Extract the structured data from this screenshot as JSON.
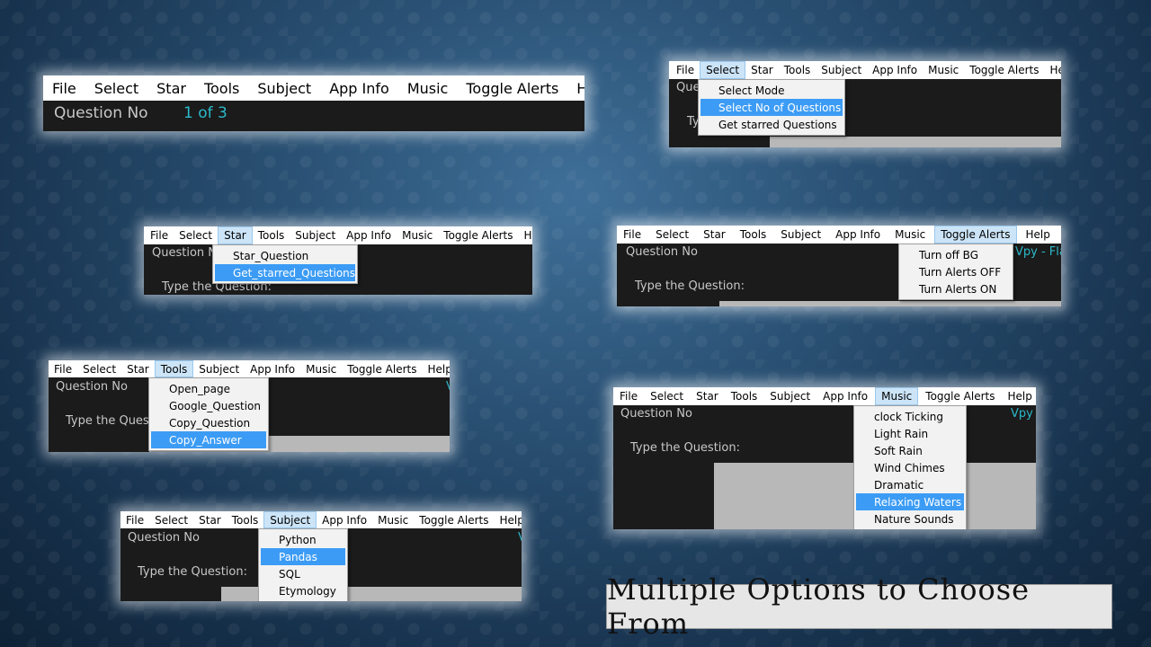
{
  "caption": "Multiple Options to Choose From",
  "menu": [
    "File",
    "Select",
    "Star",
    "Tools",
    "Subject",
    "App Info",
    "Music",
    "Toggle Alerts",
    "Help"
  ],
  "labels": {
    "question_no": "Question No",
    "question_value": "1 of 3",
    "type_question": "Type the Question:",
    "type_question_trunc": "Type the Quest",
    "vpy_fla": "Vpy - Fla",
    "vpy": "Vpy -",
    "v": "V"
  },
  "dropdowns": {
    "select": [
      "Select Mode",
      "Select No of Questions",
      "Get starred Questions"
    ],
    "star": [
      "Star_Question",
      "Get_starred_Questions"
    ],
    "toggle": [
      "Turn off BG",
      "Turn Alerts OFF",
      "Turn Alerts ON"
    ],
    "tools": [
      "Open_page",
      "Google_Question",
      "Copy_Question",
      "Copy_Answer"
    ],
    "music": [
      "clock Ticking",
      "Light Rain",
      "Soft Rain",
      "Wind Chimes",
      "Dramatic",
      "Relaxing Waters",
      "Nature Sounds"
    ],
    "subject": [
      "Python",
      "Pandas",
      "SQL",
      "Etymology"
    ]
  },
  "highlighted": {
    "select": "Select No of Questions",
    "star": "Get_starred_Questions",
    "tools": "Copy_Answer",
    "music": "Relaxing Waters",
    "subject": "Pandas"
  },
  "colors": {
    "accent": "#3c9cf5",
    "cyan": "#2bb9c9",
    "dark": "#1b1b1b"
  }
}
